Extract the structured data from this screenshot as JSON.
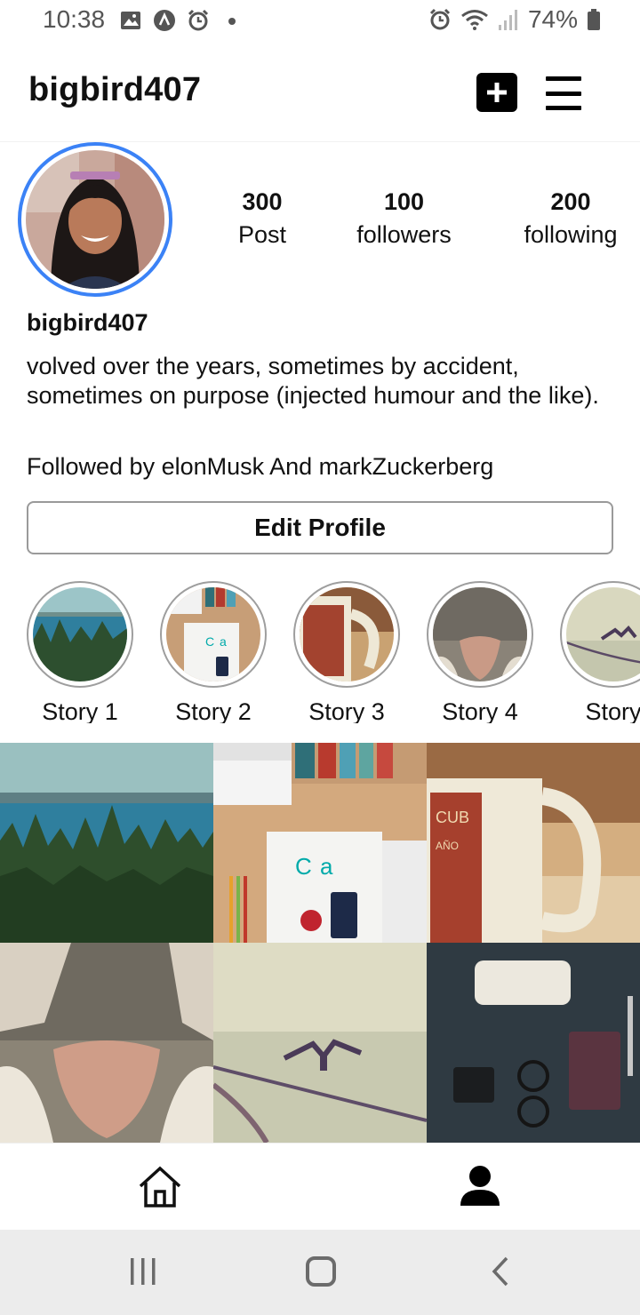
{
  "status_bar": {
    "time": "10:38",
    "battery": "74%",
    "icons": [
      "image-icon",
      "app-icon",
      "alarm-icon",
      "dot-icon",
      "alarm-icon",
      "wifi-icon",
      "signal-icon",
      "battery-icon"
    ]
  },
  "header": {
    "username": "bigbird407",
    "icons": [
      "add-post-icon",
      "menu-icon"
    ]
  },
  "profile": {
    "stats": {
      "posts_value": "300",
      "posts_label": "Post",
      "followers_value": "100",
      "followers_label": "followers",
      "following_value": "200",
      "following_label": "following"
    },
    "name": "bigbird407",
    "bio": "volved over the years, sometimes by accident, sometimes on purpose (injected humour and the like).",
    "followed_by": "Followed by elonMusk And markZuckerberg",
    "edit_button": "Edit Profile",
    "accent_ring_color": "#3b82f6"
  },
  "stories": [
    {
      "label": "Story 1",
      "image": "forest-lake"
    },
    {
      "label": "Story 2",
      "image": "desk-books"
    },
    {
      "label": "Story 3",
      "image": "coffee-mug"
    },
    {
      "label": "Story 4",
      "image": "cat-nose"
    },
    {
      "label": "Story",
      "image": "bird-on-rope"
    }
  ],
  "posts": [
    {
      "image": "forest-lake"
    },
    {
      "image": "desk-books"
    },
    {
      "image": "coffee-mug"
    },
    {
      "image": "cat-nose"
    },
    {
      "image": "bird-on-rope"
    },
    {
      "image": "dark-desk"
    }
  ],
  "bottom_nav": {
    "icons": [
      "home-icon",
      "profile-icon"
    ]
  },
  "system_nav": {
    "icons": [
      "recent-apps-icon",
      "home-circle-icon",
      "back-icon"
    ]
  }
}
